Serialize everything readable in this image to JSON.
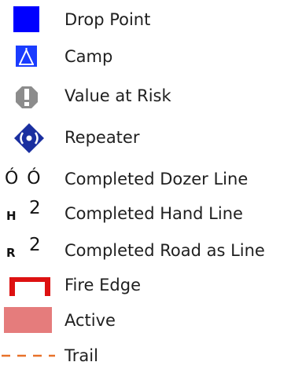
{
  "legend": {
    "items": [
      {
        "label": "Drop Point",
        "icon": "drop-point-blue-square",
        "color": "#0000ff"
      },
      {
        "label": "Camp",
        "icon": "camp-tent-icon",
        "color": "#1a3cff"
      },
      {
        "label": "Value at Risk",
        "icon": "value-at-risk-octagon-icon",
        "color": "#8c8c8c"
      },
      {
        "label": "Repeater",
        "icon": "repeater-diamond-icon",
        "color": "#1a2fa0"
      },
      {
        "label": "Completed Dozer Line",
        "icon": "dozer-line-symbol",
        "symbol_text": "Ó Ó"
      },
      {
        "label": "Completed Hand Line",
        "icon": "hand-line-symbol",
        "symbol_letter": "H",
        "symbol_number": "2"
      },
      {
        "label": "Completed Road as Line",
        "icon": "road-line-symbol",
        "symbol_letter": "R",
        "symbol_number": "2"
      },
      {
        "label": "Fire Edge",
        "icon": "fire-edge-bracket",
        "color": "#dd1111"
      },
      {
        "label": "Active",
        "icon": "active-fill-swatch",
        "color": "#e57c7c"
      },
      {
        "label": "Trail",
        "icon": "trail-dashed-line",
        "color": "#e8722a"
      }
    ]
  }
}
